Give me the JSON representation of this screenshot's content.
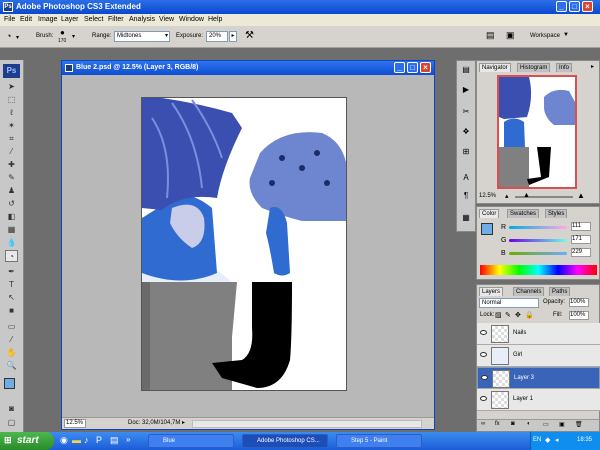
{
  "window": {
    "title": "Adobe Photoshop CS3 Extended"
  },
  "menu": [
    "File",
    "Edit",
    "Image",
    "Layer",
    "Select",
    "Filter",
    "Analysis",
    "View",
    "Window",
    "Help"
  ],
  "options": {
    "brush_label": "Brush:",
    "brush_size": "170",
    "range_label": "Range:",
    "range_value": "Midtones",
    "exposure_label": "Exposure:",
    "exposure_value": "20%",
    "workspace_label": "Workspace"
  },
  "toolbox": {
    "logo": "Ps"
  },
  "document": {
    "title": "Blue 2.psd @ 12.5% (Layer 3, RGB/8)",
    "zoom": "12.5%",
    "doc_info": "Doc: 32,0M/104,7M"
  },
  "navigator": {
    "tabs": [
      "Navigator",
      "Histogram",
      "Info"
    ],
    "zoom": "12.5%"
  },
  "color": {
    "tabs": [
      "Color",
      "Swatches",
      "Styles"
    ],
    "channels": [
      {
        "label": "R",
        "value": "111"
      },
      {
        "label": "G",
        "value": "171"
      },
      {
        "label": "B",
        "value": "229"
      }
    ],
    "foreground": "#6fabe5"
  },
  "layers": {
    "tabs": [
      "Layers",
      "Channels",
      "Paths"
    ],
    "blend_mode": "Normal",
    "opacity_label": "Opacity:",
    "opacity": "100%",
    "lock_label": "Lock:",
    "fill_label": "Fill:",
    "fill": "100%",
    "items": [
      {
        "name": "Nails",
        "selected": false
      },
      {
        "name": "Girl",
        "selected": false
      },
      {
        "name": "Layer 3",
        "selected": true
      },
      {
        "name": "Layer 1",
        "selected": false
      }
    ]
  },
  "taskbar": {
    "start": "start",
    "items": [
      {
        "label": "Blue",
        "active": false
      },
      {
        "label": "Adobe Photoshop CS...",
        "active": true
      },
      {
        "label": "Step 5 - Paint",
        "active": false
      }
    ],
    "lang": "EN",
    "time": "18:35"
  }
}
